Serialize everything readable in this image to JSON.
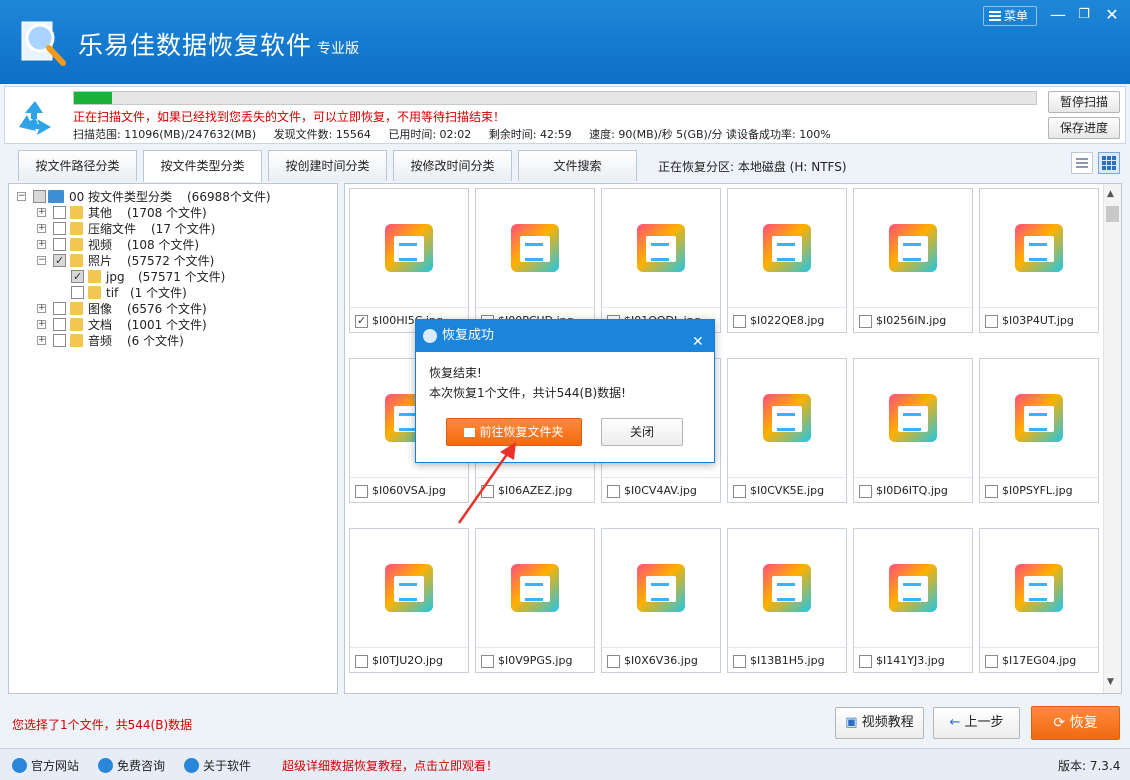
{
  "app": {
    "title": "乐易佳数据恢复软件",
    "edition": "专业版",
    "menu_label": "菜单"
  },
  "scan": {
    "progress_percent": 4,
    "message": "正在扫描文件，如果已经找到您丢失的文件，可以立即恢复，不用等待扫描结束！",
    "stats": [
      "扫描范围: 11096(MB)/247632(MB)",
      "发现文件数: 15564",
      "已用时间: 02:02",
      "剩余时间: 42:59",
      "速度: 90(MB)/秒  5(GB)/分  读设备成功率: 100%"
    ],
    "pause_label": "暂停扫描",
    "save_label": "保存进度"
  },
  "tabs": [
    {
      "label": "按文件路径分类"
    },
    {
      "label": "按文件类型分类"
    },
    {
      "label": "按创建时间分类"
    },
    {
      "label": "按修改时间分类"
    },
    {
      "label": "文件搜索"
    }
  ],
  "partition_text": "正在恢复分区: 本地磁盘 (H: NTFS)",
  "tree": {
    "root": {
      "prefix": "00",
      "label": "按文件类型分类",
      "count": "(66988个文件)"
    },
    "items": [
      {
        "label": "其他",
        "count": "(1708 个文件)"
      },
      {
        "label": "压缩文件",
        "count": "(17 个文件)"
      },
      {
        "label": "视频",
        "count": "(108 个文件)"
      },
      {
        "label": "照片",
        "count": "(57572 个文件)"
      },
      {
        "label": "jpg",
        "count": "(57571 个文件)"
      },
      {
        "label": "tif",
        "count": "(1 个文件)"
      },
      {
        "label": "图像",
        "count": "(6576 个文件)"
      },
      {
        "label": "文档",
        "count": "(1001 个文件)"
      },
      {
        "label": "音频",
        "count": "(6 个文件)"
      }
    ]
  },
  "files": [
    {
      "name": "$I00HI5C.jpg",
      "checked": true
    },
    {
      "name": "$I00PCUD.jpg",
      "checked": false
    },
    {
      "name": "$I01OODL.jpg",
      "checked": false
    },
    {
      "name": "$I022QE8.jpg",
      "checked": false
    },
    {
      "name": "$I0256IN.jpg",
      "checked": false
    },
    {
      "name": "$I03P4UT.jpg",
      "checked": false
    },
    {
      "name": "$I060VSA.jpg",
      "checked": false
    },
    {
      "name": "$I06AZEZ.jpg",
      "checked": false
    },
    {
      "name": "$I0CV4AV.jpg",
      "checked": false
    },
    {
      "name": "$I0CVK5E.jpg",
      "checked": false
    },
    {
      "name": "$I0D6ITQ.jpg",
      "checked": false
    },
    {
      "name": "$I0PSYFL.jpg",
      "checked": false
    },
    {
      "name": "$I0TJU2O.jpg",
      "checked": false
    },
    {
      "name": "$I0V9PGS.jpg",
      "checked": false
    },
    {
      "name": "$I0X6V36.jpg",
      "checked": false
    },
    {
      "name": "$I13B1H5.jpg",
      "checked": false
    },
    {
      "name": "$I141YJ3.jpg",
      "checked": false
    },
    {
      "name": "$I17EG04.jpg",
      "checked": false
    }
  ],
  "dialog": {
    "title": "恢复成功",
    "line1": "恢复结束!",
    "line2": "本次恢复1个文件，共计544(B)数据!",
    "open_label": "前往恢复文件夹",
    "close_label": "关闭"
  },
  "selection_status": "您选择了1个文件，共544(B)数据",
  "bottom": {
    "tutorial_label": "视频教程",
    "prev_label": "上一步",
    "recover_label": "恢复"
  },
  "footer": {
    "site_label": "官方网站",
    "consult_label": "免费咨询",
    "about_label": "关于软件",
    "promo": "超级详细数据恢复教程，点击立即观看！",
    "version": "版本: 7.3.4"
  },
  "colors": {
    "accent": "#1b84db",
    "progress": "#19b33a",
    "warning": "#d40000",
    "orange": "#f06a12"
  }
}
